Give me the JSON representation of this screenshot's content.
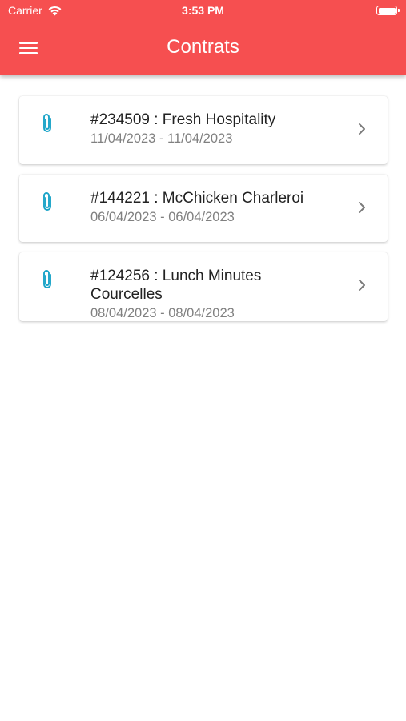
{
  "status_bar": {
    "carrier": "Carrier",
    "time": "3:53 PM"
  },
  "header": {
    "title": "Contrats",
    "menu_icon": "hamburger-menu-icon"
  },
  "colors": {
    "header_bg": "#f64f50",
    "accent_icon": "#1aa4c8",
    "chevron": "#7a7a7a"
  },
  "contracts": [
    {
      "title": "#234509 : Fresh Hospitality",
      "dates": "11/04/2023 - 11/04/2023",
      "icon": "paperclip-icon"
    },
    {
      "title": "#144221 : McChicken Charleroi",
      "dates": "06/04/2023 - 06/04/2023",
      "icon": "paperclip-icon"
    },
    {
      "title": "#124256 : Lunch Minutes Courcelles",
      "dates": "08/04/2023 - 08/04/2023",
      "icon": "paperclip-icon"
    }
  ]
}
